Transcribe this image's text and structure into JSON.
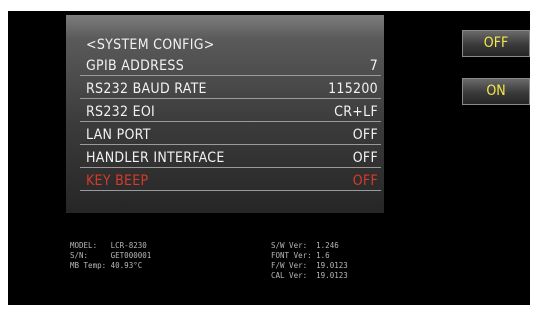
{
  "menu": {
    "title": "<SYSTEM CONFIG>",
    "items": [
      {
        "label": "GPIB ADDRESS",
        "value": "7"
      },
      {
        "label": "RS232 BAUD RATE",
        "value": "115200"
      },
      {
        "label": "RS232 EOI",
        "value": "CR+LF"
      },
      {
        "label": "LAN PORT",
        "value": "OFF"
      },
      {
        "label": "HANDLER INTERFACE",
        "value": "OFF"
      },
      {
        "label": "KEY BEEP",
        "value": "OFF"
      }
    ],
    "highlight_color": "#d63b2a"
  },
  "softkeys": {
    "top": "OFF",
    "second": "ON",
    "text_color": "#f3e84a"
  },
  "device_info": {
    "model_label": "MODEL:",
    "model_value": "LCR-8230",
    "sn_label": "S/N:",
    "sn_value": "GET000001",
    "mb_temp_label": "MB Temp:",
    "mb_temp_value": "40.93°C",
    "sw_ver_label": "S/W Ver:",
    "sw_ver_value": "1.246",
    "font_ver_label": "FONT Ver:",
    "font_ver_value": "1.6",
    "fw_ver_label": "F/W Ver:",
    "fw_ver_value": "19.0123",
    "cal_ver_label": "CAL Ver:",
    "cal_ver_value": "19.0123"
  }
}
